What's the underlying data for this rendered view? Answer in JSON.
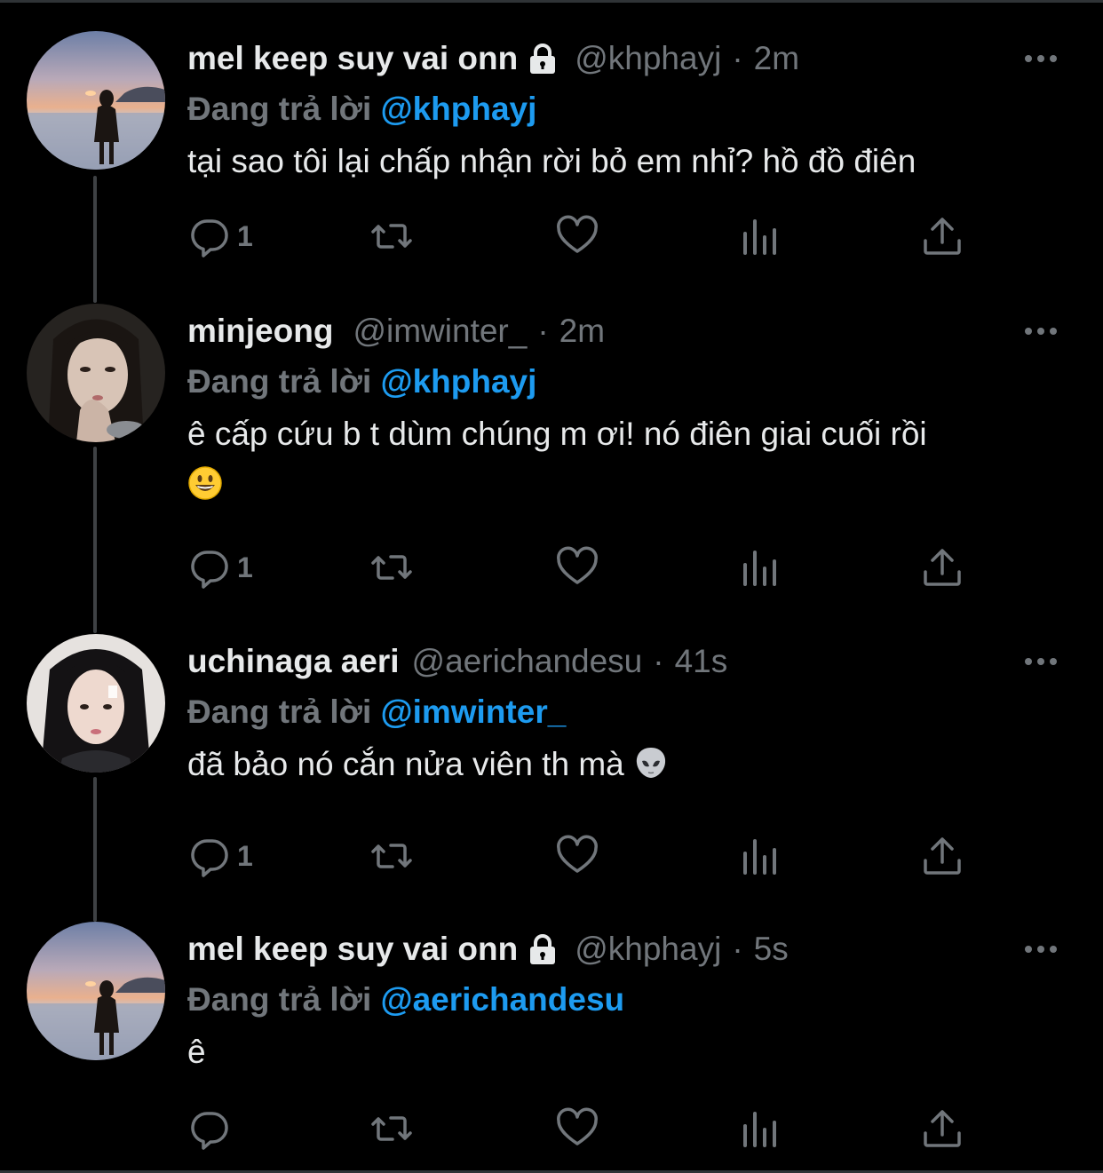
{
  "tweets": [
    {
      "name": "mel keep suy vai onn",
      "locked": true,
      "handle": "@khphayj",
      "separator": "·",
      "time": "2m",
      "replying_label": "Đang trả lời",
      "replying_to": "@khphayj",
      "text": "tại sao tôi lại chấp nhận rời bỏ em nhỉ? hồ đồ điên",
      "text2": "",
      "reply_count": "1",
      "avatar": "sunset-beach-photo"
    },
    {
      "name": "minjeong",
      "locked": false,
      "handle": "@imwinter_",
      "separator": "·",
      "time": "2m",
      "replying_label": "Đang trả lời",
      "replying_to": "@khphayj",
      "text": "ê cấp cứu b t dùm chúng m ơi! nó điên giai cuối rồi",
      "text2": "",
      "reply_count": "1",
      "avatar": "girl-portrait-photo"
    },
    {
      "name": "uchinaga aeri",
      "locked": false,
      "handle": "@aerichandesu",
      "separator": "·",
      "time": "41s",
      "replying_label": "Đang trả lời",
      "replying_to": "@imwinter_",
      "text": "đã bảo nó cắn nửa viên th mà",
      "text2": "",
      "reply_count": "1",
      "avatar": "girl-portrait-photo-2"
    },
    {
      "name": "mel keep suy vai onn",
      "locked": true,
      "handle": "@khphayj",
      "separator": "·",
      "time": "5s",
      "replying_label": "Đang trả lời",
      "replying_to": "@aerichandesu",
      "text": "ê",
      "text2": "",
      "reply_count": "",
      "avatar": "sunset-beach-photo"
    }
  ],
  "icons": {
    "reply": "reply-icon",
    "retweet": "retweet-icon",
    "like": "like-icon",
    "views": "analytics-icon",
    "share": "share-icon",
    "more": "more-icon",
    "lock": "lock-icon"
  },
  "colors": {
    "background": "#000000",
    "text": "#e7e9ea",
    "muted": "#71767b",
    "accent": "#1d9bf0"
  }
}
